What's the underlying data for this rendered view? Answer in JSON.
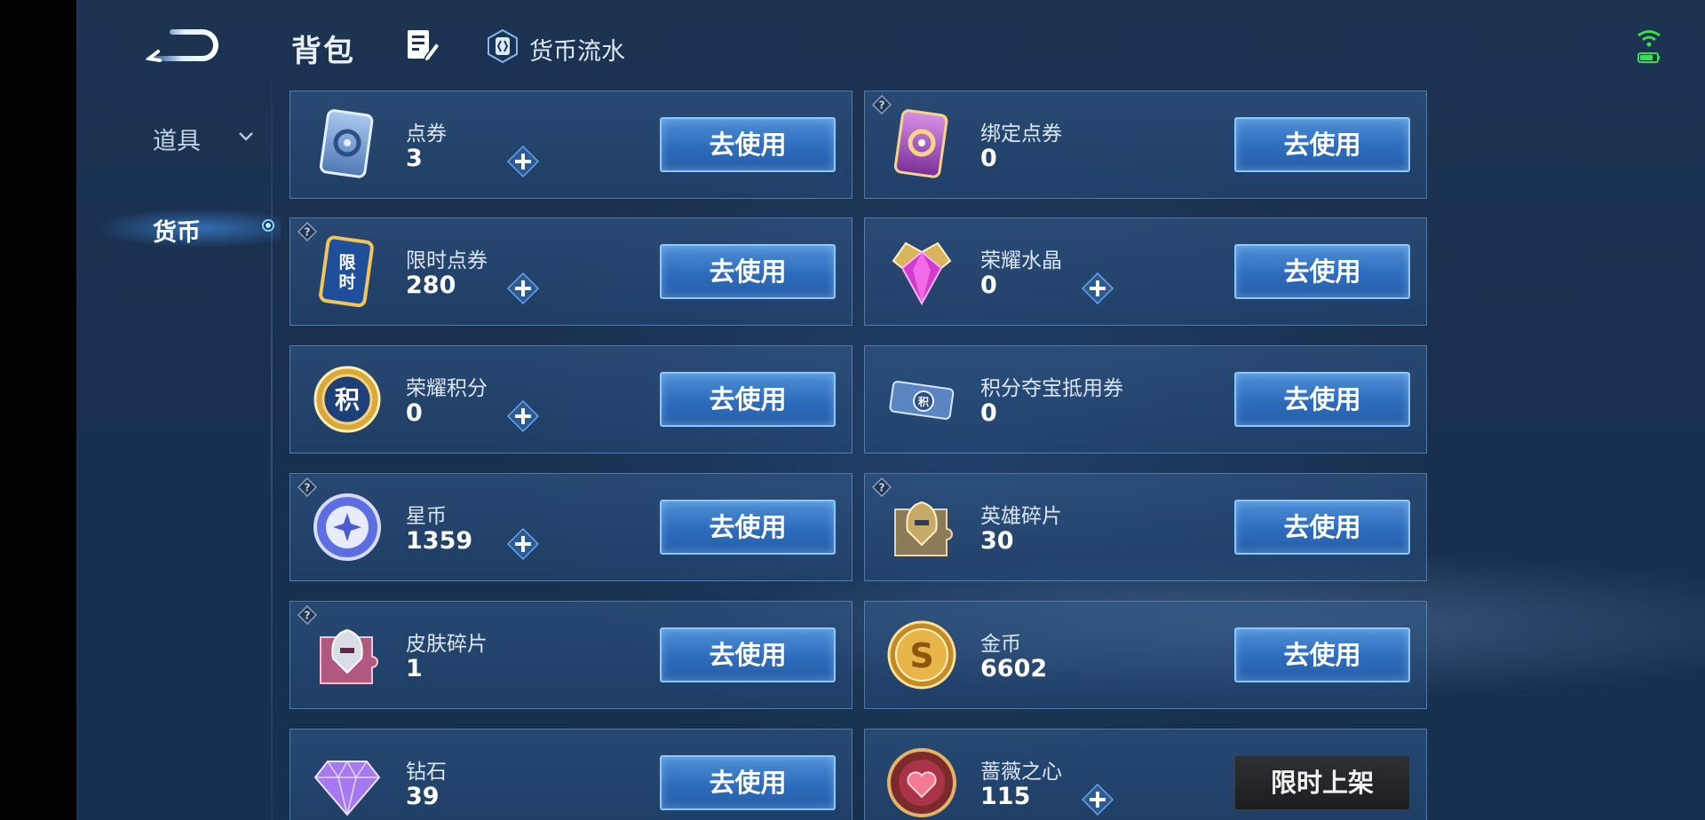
{
  "header": {
    "title": "背包",
    "flow_label": "货币流水"
  },
  "nav": {
    "props_label": "道具",
    "currency_label": "货币"
  },
  "colors": {
    "button_blue": "#2e6cbc",
    "card_bg": "#2b5488",
    "limited_dark": "#1b1d20",
    "wifi_green": "#3ddc4a"
  },
  "items": [
    {
      "name": "点券",
      "value": "3",
      "action": "去使用",
      "icon": "voucher-card-icon",
      "has_plus": true,
      "has_help": false
    },
    {
      "name": "绑定点券",
      "value": "0",
      "action": "去使用",
      "icon": "bound-voucher-card-icon",
      "has_plus": false,
      "has_help": true
    },
    {
      "name": "限时点券",
      "value": "280",
      "action": "去使用",
      "icon": "limited-voucher-icon",
      "has_plus": true,
      "has_help": true
    },
    {
      "name": "荣耀水晶",
      "value": "0",
      "action": "去使用",
      "icon": "glory-crystal-icon",
      "has_plus": true,
      "has_help": false
    },
    {
      "name": "荣耀积分",
      "value": "0",
      "action": "去使用",
      "icon": "glory-points-coin-icon",
      "has_plus": true,
      "has_help": false
    },
    {
      "name": "积分夺宝抵用券",
      "value": "0",
      "action": "去使用",
      "icon": "points-coupon-icon",
      "has_plus": false,
      "has_help": false
    },
    {
      "name": "星币",
      "value": "1359",
      "action": "去使用",
      "icon": "star-coin-icon",
      "has_plus": true,
      "has_help": true
    },
    {
      "name": "英雄碎片",
      "value": "30",
      "action": "去使用",
      "icon": "hero-fragment-icon",
      "has_plus": false,
      "has_help": true
    },
    {
      "name": "皮肤碎片",
      "value": "1",
      "action": "去使用",
      "icon": "skin-fragment-icon",
      "has_plus": false,
      "has_help": true
    },
    {
      "name": "金币",
      "value": "6602",
      "action": "去使用",
      "icon": "gold-coin-icon",
      "has_plus": false,
      "has_help": false
    },
    {
      "name": "钻石",
      "value": "39",
      "action": "去使用",
      "icon": "diamond-icon",
      "has_plus": false,
      "has_help": false
    },
    {
      "name": "蔷薇之心",
      "value": "115",
      "action": "限时上架",
      "icon": "rose-heart-icon",
      "has_plus": true,
      "has_help": false
    }
  ]
}
